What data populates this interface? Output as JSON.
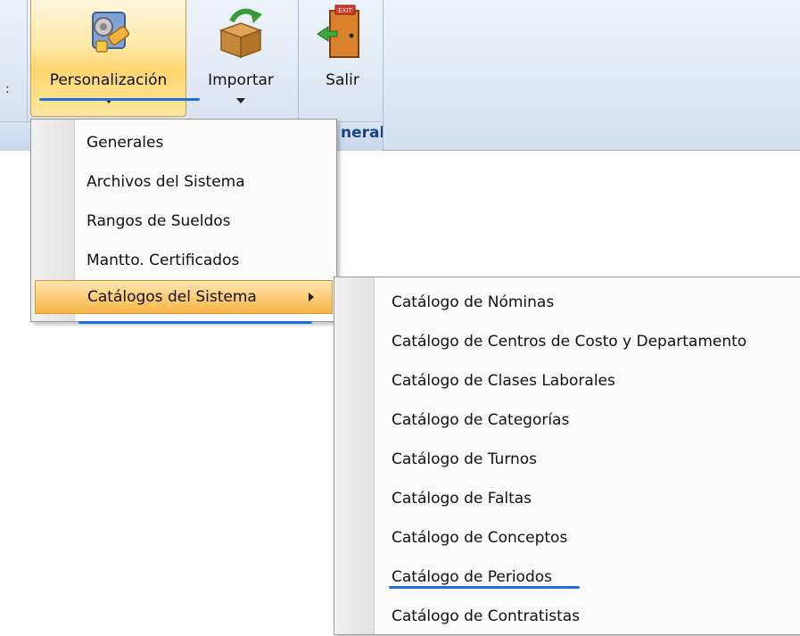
{
  "ribbon": {
    "group_label": "neral",
    "buttons": [
      {
        "label": "Personalización",
        "icon": "settings-tools-icon"
      },
      {
        "label": "Importar",
        "icon": "import-box-icon"
      },
      {
        "label": "Salir",
        "icon": "exit-door-icon"
      }
    ]
  },
  "menu_personalizacion": {
    "items": [
      {
        "label": "Generales"
      },
      {
        "label": "Archivos del Sistema"
      },
      {
        "label": "Rangos de Sueldos"
      },
      {
        "label": "Mantto. Certificados"
      },
      {
        "label": "Catálogos del Sistema",
        "has_submenu": true,
        "highlighted": true
      }
    ]
  },
  "menu_catalogos": {
    "items": [
      {
        "label": "Catálogo de Nóminas"
      },
      {
        "label": "Catálogo de Centros de Costo y Departamento"
      },
      {
        "label": "Catálogo de Clases Laborales"
      },
      {
        "label": "Catálogo de Categorías"
      },
      {
        "label": "Catálogo de Turnos"
      },
      {
        "label": "Catálogo de Faltas"
      },
      {
        "label": "Catálogo de Conceptos"
      },
      {
        "label": "Catálogo de Periodos"
      },
      {
        "label": "Catálogo de Contratistas"
      }
    ]
  },
  "colors": {
    "annotation_blue": "#1d6fe0",
    "highlight_orange": "#f8b54a",
    "ribbon_bg": "#dfe8f4",
    "group_label": "#15428b"
  }
}
